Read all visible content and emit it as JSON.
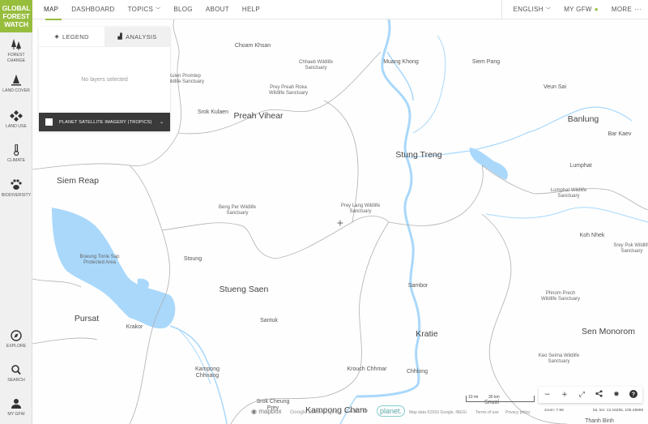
{
  "app": {
    "logo_lines": [
      "GLOBAL",
      "FOREST",
      "WATCH"
    ],
    "brand_color": "#97bd3d"
  },
  "topnav": {
    "left": [
      {
        "label": "MAP",
        "active": true
      },
      {
        "label": "DASHBOARD"
      },
      {
        "label": "TOPICS",
        "has_dropdown": true
      },
      {
        "label": "BLOG"
      },
      {
        "label": "ABOUT"
      },
      {
        "label": "HELP"
      }
    ],
    "right": [
      {
        "label": "ENGLISH",
        "has_dropdown": true
      },
      {
        "label": "MY GFW",
        "icon": "user-icon"
      },
      {
        "label": "MORE",
        "icon": "ellipsis-icon"
      }
    ]
  },
  "sidebar": {
    "top_items": [
      {
        "label_lines": [
          "FOREST",
          "CHANGE"
        ],
        "icon": "trees-icon"
      },
      {
        "label_lines": [
          "LAND COVER"
        ],
        "icon": "tree-icon"
      },
      {
        "label_lines": [
          "LAND USE"
        ],
        "icon": "diamonds-icon"
      },
      {
        "label_lines": [
          "CLIMATE"
        ],
        "icon": "thermometer-icon"
      },
      {
        "label_lines": [
          "BIODIVERSITY"
        ],
        "icon": "paw-icon"
      }
    ],
    "bottom_items": [
      {
        "label": "EXPLORE",
        "icon": "compass-icon"
      },
      {
        "label": "SEARCH",
        "icon": "search-icon"
      },
      {
        "label": "MY GFW",
        "icon": "user-icon"
      }
    ]
  },
  "legend_panel": {
    "tabs": [
      {
        "label": "LEGEND",
        "icon": "layers-icon",
        "active": true
      },
      {
        "label": "ANALYSIS",
        "icon": "bar-chart-icon",
        "active": false
      }
    ],
    "empty_message": "No layers selected",
    "planet_layer": {
      "label": "PLANET SATELLITE IMAGERY (TROPICS)",
      "checked": false
    }
  },
  "map": {
    "places": [
      {
        "name": "Choam Khsan",
        "type": "town"
      },
      {
        "name": "Chhaeb Wildlife\nSanctuary",
        "type": "park"
      },
      {
        "name": "Muang Khong",
        "type": "town"
      },
      {
        "name": "Siem Pang",
        "type": "town"
      },
      {
        "name": "Kulen Promtep\nWildlife Sanctuary",
        "type": "park"
      },
      {
        "name": "Prey Preah Roka\nWildlife Sanctuary",
        "type": "park"
      },
      {
        "name": "Veun Sai",
        "type": "town"
      },
      {
        "name": "Srok Kulaen",
        "type": "town"
      },
      {
        "name": "Preah Vihear",
        "type": "city"
      },
      {
        "name": "Banlung",
        "type": "city"
      },
      {
        "name": "Bar Kaev",
        "type": "town"
      },
      {
        "name": "Stung Treng",
        "type": "city"
      },
      {
        "name": "Lumphat",
        "type": "town"
      },
      {
        "name": "Siem Reap",
        "type": "city"
      },
      {
        "name": "Lumphat Wildlife\nSanctuary",
        "type": "park"
      },
      {
        "name": "Prey Lang Wildlife\nSanctuary",
        "type": "park"
      },
      {
        "name": "Beng Per Wildlife\nSanctuary",
        "type": "park"
      },
      {
        "name": "Koh Nhek",
        "type": "town"
      },
      {
        "name": "Srey Pok Wildlife\nSanctuary",
        "type": "park"
      },
      {
        "name": "Boeung Tonle Sap\nProtected Area",
        "type": "park"
      },
      {
        "name": "Stoung",
        "type": "town"
      },
      {
        "name": "Sambor",
        "type": "town"
      },
      {
        "name": "Stueng Saen",
        "type": "city"
      },
      {
        "name": "Phnom Prech\nWildlife Sanctuary",
        "type": "park"
      },
      {
        "name": "Pursat",
        "type": "city"
      },
      {
        "name": "Krakor",
        "type": "town"
      },
      {
        "name": "Santuk",
        "type": "town"
      },
      {
        "name": "Kratie",
        "type": "city"
      },
      {
        "name": "Sen Monorom",
        "type": "city"
      },
      {
        "name": "Keo Seima Wildlife\nSanctuary",
        "type": "park"
      },
      {
        "name": "Kampong\nChhnang",
        "type": "town"
      },
      {
        "name": "Krouch Chhmar",
        "type": "town"
      },
      {
        "name": "Chhlong",
        "type": "town"
      },
      {
        "name": "Srok Cheung\nPrey",
        "type": "town"
      },
      {
        "name": "Kampong Cham",
        "type": "city"
      },
      {
        "name": "Snuol",
        "type": "town"
      },
      {
        "name": "Thanh Binh",
        "type": "town"
      }
    ],
    "water_color": "#a9d8fb",
    "boundary_color": "#aaaaaa"
  },
  "controls": {
    "buttons": [
      {
        "name": "zoom-out",
        "glyph": "−"
      },
      {
        "name": "zoom-in",
        "glyph": "+"
      },
      {
        "name": "fullscreen",
        "glyph": "⤢"
      },
      {
        "name": "share",
        "glyph": "<"
      },
      {
        "name": "settings",
        "glyph": "✹"
      },
      {
        "name": "help",
        "glyph": "?"
      }
    ],
    "zoom_text": "zoom: 7.98",
    "latlon_text": "lat, lon: 13.16255, 105.48665"
  },
  "attribution": {
    "mapbox": "mapbox",
    "google": "Google Earth Engine",
    "carto": "CARTO",
    "planet": "planet.",
    "map_data": "Map data ©2016 Google, INEGI",
    "terms": "Terms of use",
    "privacy": "Privacy policy",
    "scale_mi": "10 mi",
    "scale_km": "30 km"
  }
}
